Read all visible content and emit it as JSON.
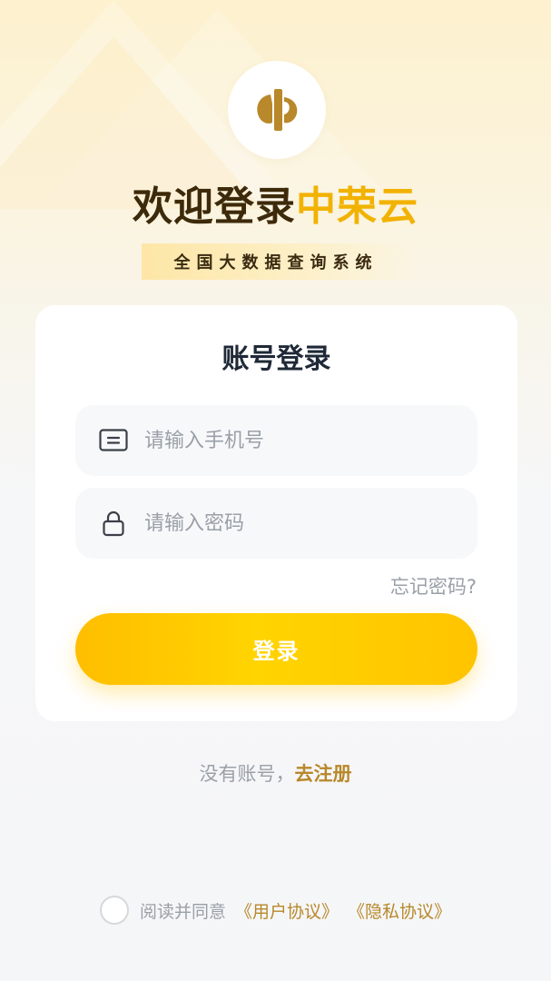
{
  "header": {
    "title_part1": "欢迎登录",
    "title_part2": "中荣云",
    "subtitle": "全国大数据查询系统"
  },
  "login_card": {
    "title": "账号登录",
    "phone": {
      "placeholder": "请输入手机号",
      "value": "",
      "icon": "id-card-icon"
    },
    "password": {
      "placeholder": "请输入密码",
      "value": "",
      "icon": "lock-icon"
    },
    "forgot_label": "忘记密码?",
    "login_label": "登录"
  },
  "register": {
    "prompt": "没有账号，",
    "link": "去注册"
  },
  "agreement": {
    "checked": false,
    "prefix": "阅读并同意",
    "user_agreement": "《用户协议》",
    "privacy_policy": "《隐私协议》"
  },
  "colors": {
    "accent": "#f2b200",
    "button": "#ffcc00",
    "link": "#b8882a",
    "title_dark": "#3d2a0a"
  }
}
